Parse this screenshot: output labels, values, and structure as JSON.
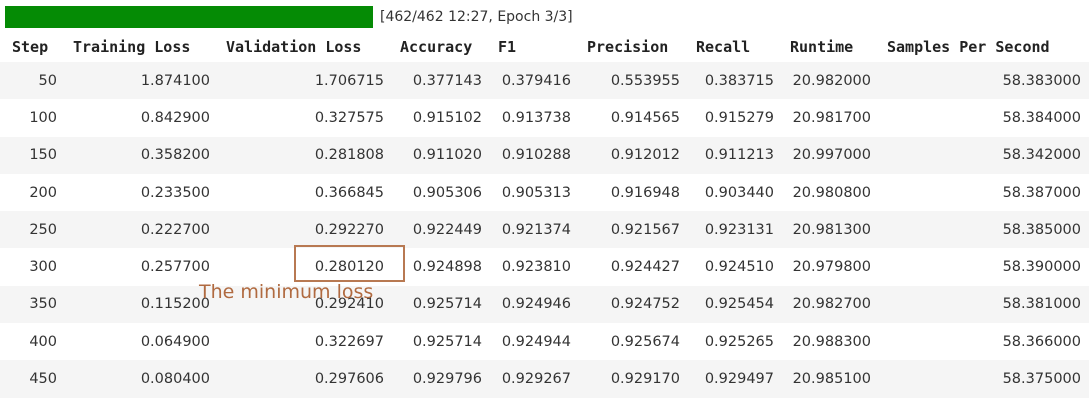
{
  "progress": {
    "fraction": 1.0,
    "text": "[462/462 12:27, Epoch 3/3]",
    "fill_color": "#058b05"
  },
  "table": {
    "columns": [
      "Step",
      "Training Loss",
      "Validation Loss",
      "Accuracy",
      "F1",
      "Precision",
      "Recall",
      "Runtime",
      "Samples Per Second"
    ],
    "rows": [
      [
        "50",
        "1.874100",
        "1.706715",
        "0.377143",
        "0.379416",
        "0.553955",
        "0.383715",
        "20.982000",
        "58.383000"
      ],
      [
        "100",
        "0.842900",
        "0.327575",
        "0.915102",
        "0.913738",
        "0.914565",
        "0.915279",
        "20.981700",
        "58.384000"
      ],
      [
        "150",
        "0.358200",
        "0.281808",
        "0.911020",
        "0.910288",
        "0.912012",
        "0.911213",
        "20.997000",
        "58.342000"
      ],
      [
        "200",
        "0.233500",
        "0.366845",
        "0.905306",
        "0.905313",
        "0.916948",
        "0.903440",
        "20.980800",
        "58.387000"
      ],
      [
        "250",
        "0.222700",
        "0.292270",
        "0.922449",
        "0.921374",
        "0.921567",
        "0.923131",
        "20.981300",
        "58.385000"
      ],
      [
        "300",
        "0.257700",
        "0.280120",
        "0.924898",
        "0.923810",
        "0.924427",
        "0.924510",
        "20.979800",
        "58.390000"
      ],
      [
        "350",
        "0.115200",
        "0.292410",
        "0.925714",
        "0.924946",
        "0.924752",
        "0.925454",
        "20.982700",
        "58.381000"
      ],
      [
        "400",
        "0.064900",
        "0.322697",
        "0.925714",
        "0.924944",
        "0.925674",
        "0.925265",
        "20.988300",
        "58.366000"
      ],
      [
        "450",
        "0.080400",
        "0.297606",
        "0.929796",
        "0.929267",
        "0.929170",
        "0.929497",
        "20.985100",
        "58.375000"
      ]
    ]
  },
  "annotation": {
    "text": "The minimum loss",
    "color": "#b06a40"
  }
}
